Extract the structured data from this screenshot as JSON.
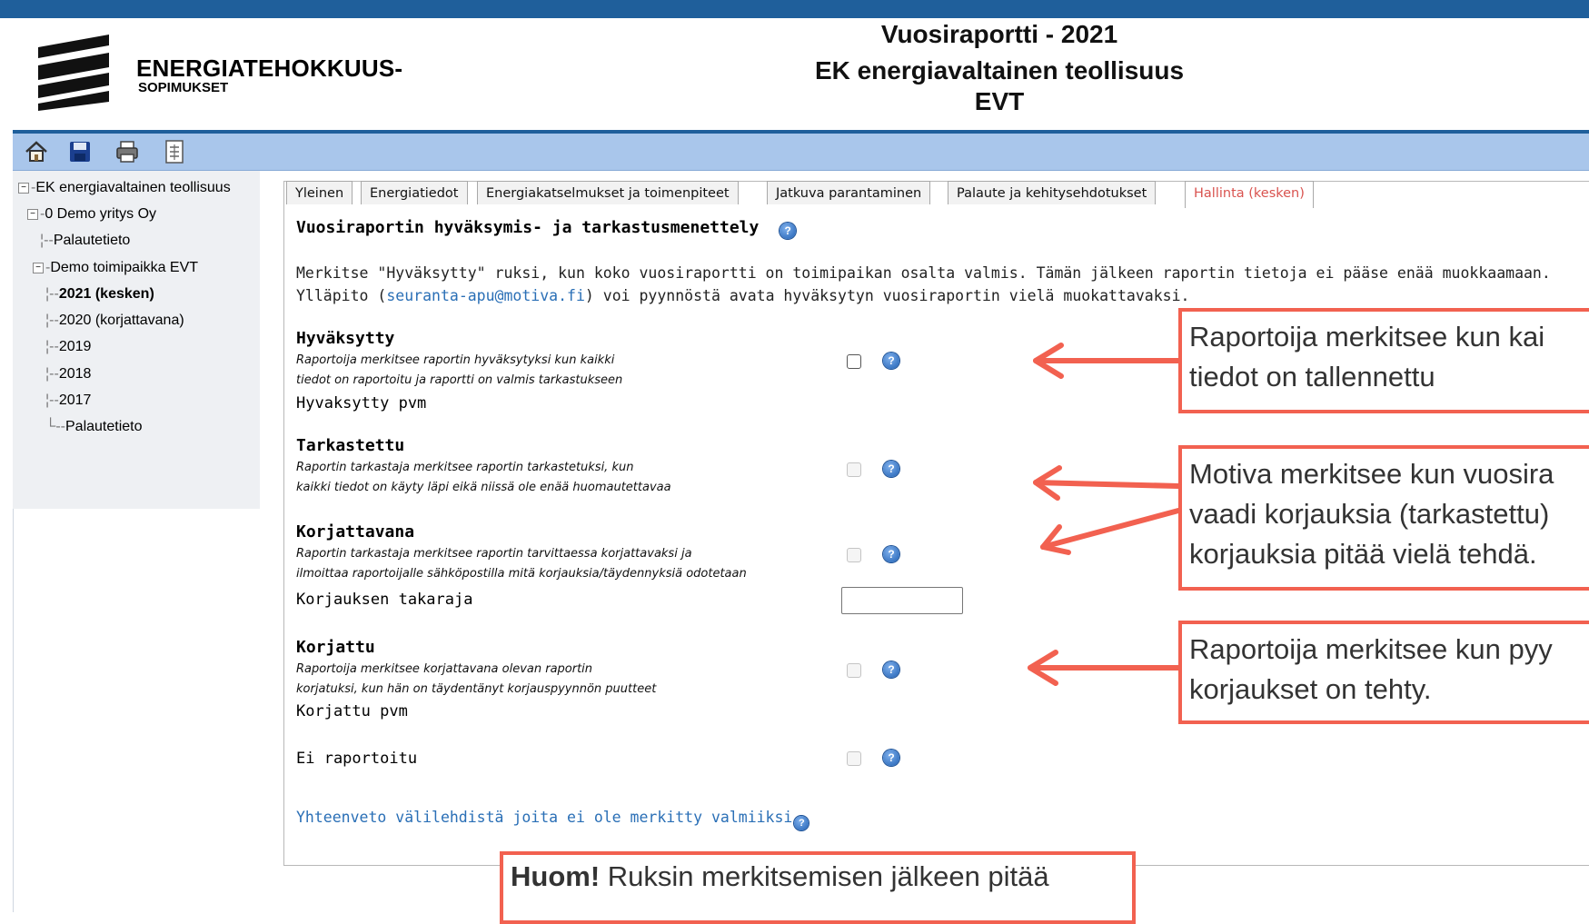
{
  "header": {
    "logo_line1": "ENERGIATEHOKKUUS-",
    "logo_line2": "SOPIMUKSET",
    "title_line1": "Vuosiraportti - 2021",
    "title_line2": "EK energiavaltainen teollisuus",
    "title_line3": "EVT"
  },
  "toolbar": {
    "icons": [
      "home-icon",
      "save-icon",
      "print-icon",
      "export-icon"
    ]
  },
  "tree": {
    "root": "EK energiavaltainen teollisuus",
    "company": "0 Demo yritys Oy",
    "company_feedback": "Palautetieto",
    "site": "Demo toimipaikka EVT",
    "years": [
      "2021 (kesken)",
      "2020 (korjattavana)",
      "2019",
      "2018",
      "2017"
    ],
    "site_feedback": "Palautetieto"
  },
  "tabs": [
    {
      "label": "Yleinen"
    },
    {
      "label": "Energiatiedot"
    },
    {
      "label": "Energiakatselmukset ja toimenpiteet"
    },
    {
      "label": "Jatkuva parantaminen"
    },
    {
      "label": "Palaute ja kehitysehdotukset"
    },
    {
      "label": "Hallinta (kesken)"
    }
  ],
  "section": {
    "title": "Vuosiraportin hyväksymis- ja tarkastusmenettely",
    "intro_line1": "Merkitse \"Hyväksytty\" ruksi, kun koko vuosiraportti on toimipaikan osalta valmis. Tämän jälkeen raportin tietoja ei pääse enää muokkaamaan.",
    "intro_line2_pre": "Ylläpito (",
    "intro_link": "seuranta-apu@motiva.fi",
    "intro_line2_post": ") voi pyynnöstä avata hyväksytyn vuosiraportin vielä muokattavaksi."
  },
  "items": {
    "hyvaksytty": {
      "label": "Hyväksytty",
      "desc1": "Raportoija merkitsee raportin hyväksytyksi kun kaikki",
      "desc2": "tiedot on raportoitu ja raportti on valmis tarkastukseen",
      "sub": "Hyvaksytty pvm"
    },
    "tarkastettu": {
      "label": "Tarkastettu",
      "desc1": "Raportin tarkastaja merkitsee raportin tarkastetuksi, kun",
      "desc2": "kaikki tiedot on käyty läpi eikä niissä ole enää huomautettavaa"
    },
    "korjattavana": {
      "label": "Korjattavana",
      "desc1": "Raportin tarkastaja merkitsee raportin tarvittaessa korjattavaksi ja",
      "desc2": "ilmoittaa raportoijalle sähköpostilla mitä korjauksia/täydennyksiä odotetaan",
      "sub": "Korjauksen takaraja"
    },
    "korjattu": {
      "label": "Korjattu",
      "desc1": "Raportoija merkitsee korjattavana olevan raportin",
      "desc2": "korjatuksi, kun hän on täydentänyt korjauspyynnön puutteet",
      "sub": "Korjattu pvm"
    },
    "ei_raportoitu": {
      "label": "Ei raportoitu"
    }
  },
  "summary_link": "Yhteenveto välilehdistä joita ei ole merkitty valmiiksi",
  "callouts": {
    "c1_line1": "Raportoija merkitsee kun kai",
    "c1_line2": "tiedot on tallennettu",
    "c2_line1": "Motiva merkitsee kun vuosira",
    "c2_line2": "vaadi korjauksia (tarkastettu)",
    "c2_line3": "korjauksia pitää vielä tehdä.",
    "c3_line1": "Raportoija merkitsee kun pyy",
    "c3_line2": "korjaukset on tehty.",
    "c4_bold": "Huom!",
    "c4_rest": " Ruksin merkitsemisen jälkeen pitää"
  },
  "colors": {
    "brand_blue": "#1f5f9b",
    "toolbar": "#a9c6eb",
    "callout_red": "#f26150",
    "active_tab": "#d9534f",
    "link": "#2a6fb6"
  }
}
